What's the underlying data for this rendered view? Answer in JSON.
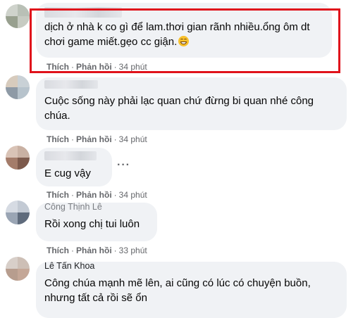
{
  "comments": [
    {
      "author": "",
      "text": "dịch ở nhà k co gì để lam.thơi gian rãnh nhiều.ổng ôm dt chơi game miết.gẹo cc giận.",
      "emoji": "grinning-face",
      "like": "Thích",
      "reply": "Phản hồi",
      "time": "34 phút",
      "highlighted": true
    },
    {
      "author": "",
      "text": "Cuộc sống này phải lạc quan chứ đừng bi quan nhé công chúa.",
      "like": "Thích",
      "reply": "Phản hồi",
      "time": "34 phút"
    },
    {
      "author": "",
      "text": "E cug vậy",
      "like": "Thích",
      "reply": "Phản hồi",
      "time": "34 phút",
      "more": "···"
    },
    {
      "author": "Công Thịnh Lê",
      "text": "Rồi xong chị tui luôn",
      "like": "Thích",
      "reply": "Phản hồi",
      "time": "33 phút"
    },
    {
      "author": "Lê Tấn Khoa",
      "text": "Công chúa mạnh mẽ lên, ai cũng có lúc có chuyện buồn, nhưng tất cả rồi sẽ ổn"
    }
  ],
  "separator": "·",
  "colors": {
    "bubble": "#f0f2f5",
    "meta": "#65676b",
    "highlight_border": "#e0121b",
    "text": "#050505"
  }
}
